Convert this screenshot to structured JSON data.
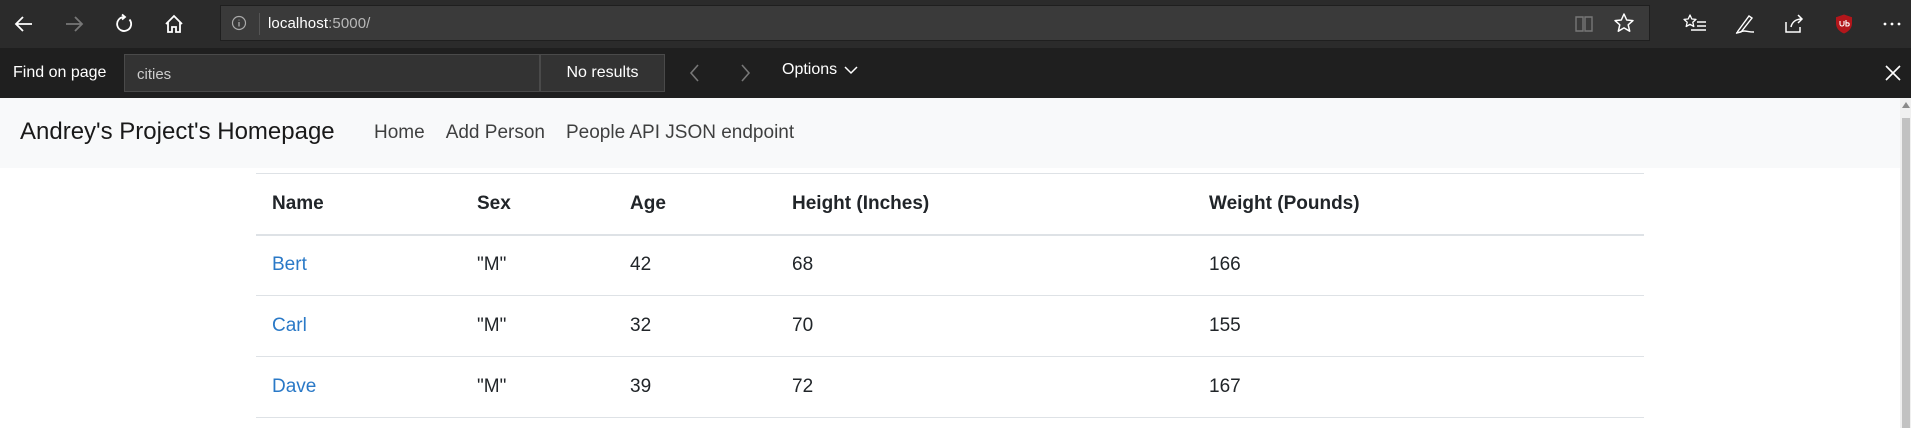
{
  "browser": {
    "url_host": "localhost",
    "url_rest": ":5000/"
  },
  "find_bar": {
    "label": "Find on page",
    "query": "cities",
    "results": "No results",
    "options_label": "Options"
  },
  "navbar": {
    "brand": "Andrey's Project's Homepage",
    "links": [
      "Home",
      "Add Person",
      "People API JSON endpoint"
    ]
  },
  "table": {
    "columns": [
      "Name",
      "Sex",
      "Age",
      "Height (Inches)",
      "Weight (Pounds)"
    ],
    "rows": [
      {
        "name": "Bert",
        "sex": "\"M\"",
        "age": "42",
        "height": "68",
        "weight": "166"
      },
      {
        "name": "Carl",
        "sex": "\"M\"",
        "age": "32",
        "height": "70",
        "weight": "155"
      },
      {
        "name": "Dave",
        "sex": "\"M\"",
        "age": "39",
        "height": "72",
        "weight": "167"
      }
    ]
  },
  "colors": {
    "toolbar_bg": "#2b2b2b",
    "findbar_bg": "#1f1f1f",
    "navbar_bg": "#f8f9fa",
    "link": "#2a79c7",
    "ublock": "#b3161b"
  }
}
